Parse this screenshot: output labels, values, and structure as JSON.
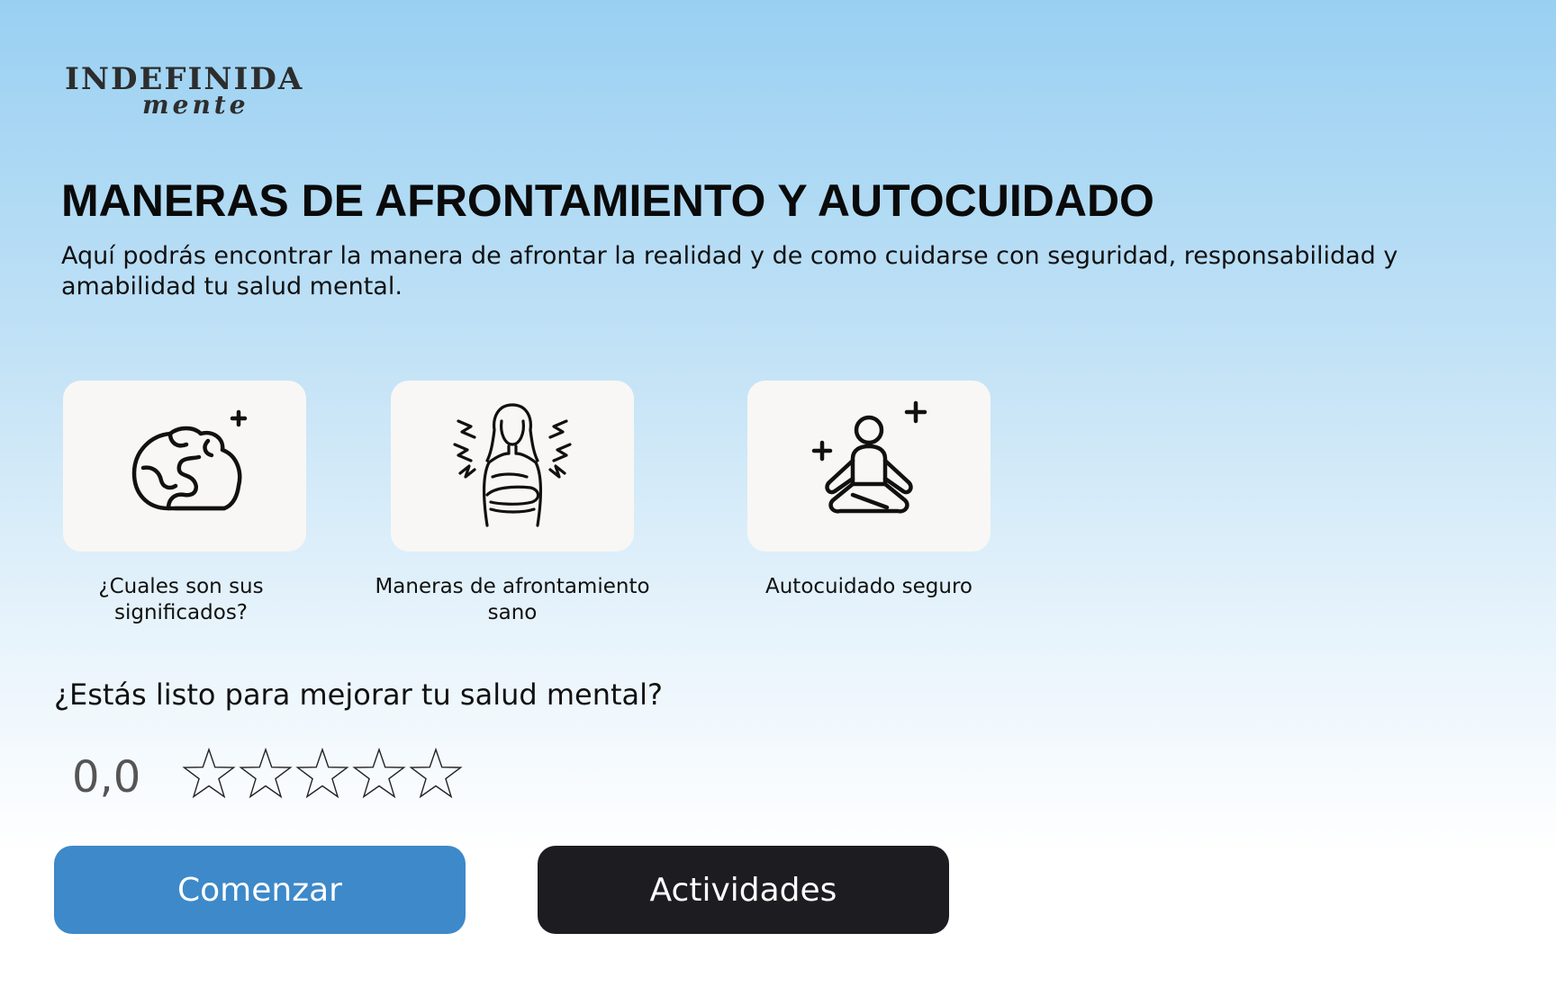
{
  "brand": {
    "logo_main": "INDEFINIDA",
    "logo_sub": "mente"
  },
  "header": {
    "title": "MANERAS DE AFRONTAMIENTO Y AUTOCUIDADO",
    "description": "Aquí podrás encontrar la manera de afrontar la realidad y de como cuidarse con seguridad, responsabilidad y amabilidad tu salud mental."
  },
  "cards": [
    {
      "label": "¿Cuales son sus significados?",
      "icon": "brain-sparkle-icon"
    },
    {
      "label": "Maneras de afrontamiento sano",
      "icon": "stressed-person-icon"
    },
    {
      "label": "Autocuidado seguro",
      "icon": "meditation-icon"
    }
  ],
  "rating": {
    "question": "¿Estás listo para mejorar tu salud mental?",
    "value": "0,0",
    "max_stars": 5,
    "filled_stars": 0
  },
  "actions": {
    "start_label": "Comenzar",
    "activities_label": "Actividades"
  },
  "colors": {
    "primary_button": "#3d89c9",
    "dark_button": "#1d1c20",
    "card_background": "#f8f7f5",
    "gradient_top": "#99d0f2"
  }
}
